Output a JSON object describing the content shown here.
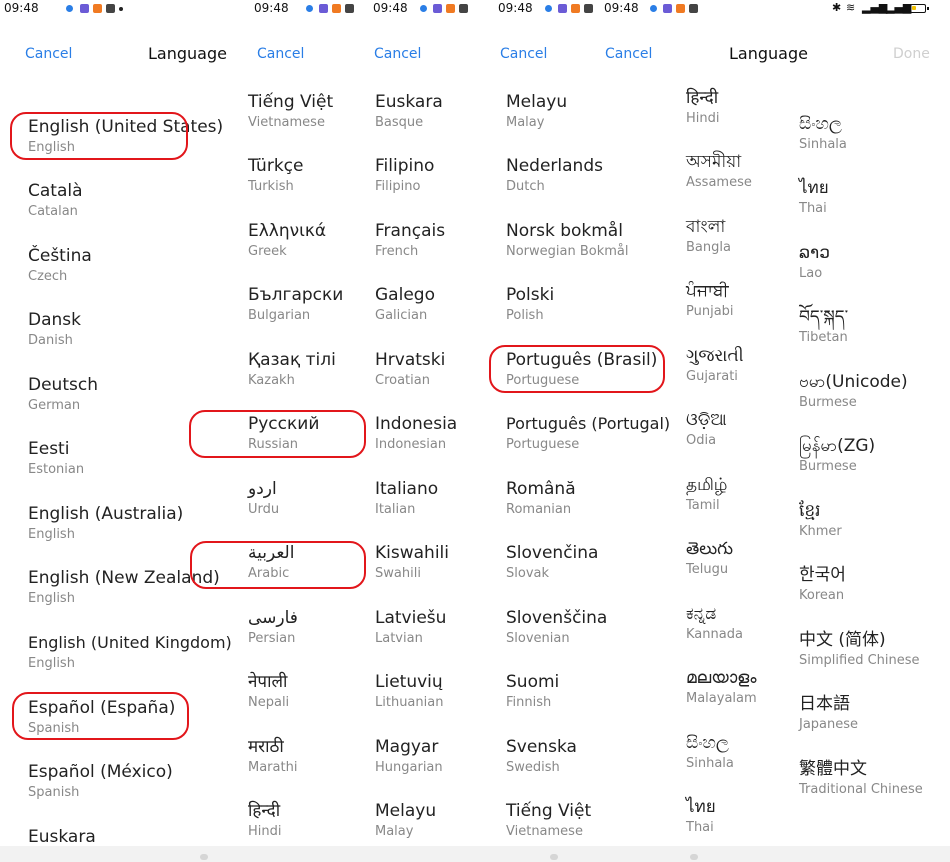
{
  "colors": {
    "accent": "#2a7ee6",
    "highlight": "#e2161b",
    "battery": "#f2c200"
  },
  "status": {
    "time": "09:48",
    "icons": [
      "notification-dot-icon",
      "app-icon",
      "app-icon",
      "app-icon",
      "app-icon"
    ]
  },
  "header": {
    "cancel": "Cancel",
    "title": "Language",
    "done": "Done"
  },
  "panel1": {
    "items": [
      {
        "native": "English (United States)",
        "eng": "English",
        "highlighted": true
      },
      {
        "native": "Català",
        "eng": "Catalan"
      },
      {
        "native": "Čeština",
        "eng": "Czech"
      },
      {
        "native": "Dansk",
        "eng": "Danish"
      },
      {
        "native": "Deutsch",
        "eng": "German"
      },
      {
        "native": "Eesti",
        "eng": "Estonian"
      },
      {
        "native": "English (Australia)",
        "eng": "English"
      },
      {
        "native": "English (New Zealand)",
        "eng": "English"
      },
      {
        "native": "English (United Kingdom)",
        "eng": "English"
      },
      {
        "native": "Español (España)",
        "eng": "Spanish",
        "highlighted": true
      },
      {
        "native": "Español (México)",
        "eng": "Spanish"
      },
      {
        "native": "Euskara",
        "eng": ""
      }
    ]
  },
  "panel2": {
    "items": [
      {
        "native": "Tiếng Việt",
        "eng": "Vietnamese"
      },
      {
        "native": "Türkçe",
        "eng": "Turkish"
      },
      {
        "native": "Ελληνικά",
        "eng": "Greek"
      },
      {
        "native": "Български",
        "eng": "Bulgarian"
      },
      {
        "native": "Қазақ тілі",
        "eng": "Kazakh"
      },
      {
        "native": "Русский",
        "eng": "Russian",
        "highlighted": true
      },
      {
        "native": "اردو",
        "eng": "Urdu"
      },
      {
        "native": "العربية",
        "eng": "Arabic",
        "highlighted": true
      },
      {
        "native": "فارسی",
        "eng": "Persian"
      },
      {
        "native": "नेपाली",
        "eng": "Nepali"
      },
      {
        "native": "मराठी",
        "eng": "Marathi"
      },
      {
        "native": "हिन्दी",
        "eng": "Hindi"
      }
    ]
  },
  "panel3": {
    "items": [
      {
        "native": "Euskara",
        "eng": "Basque"
      },
      {
        "native": "Filipino",
        "eng": "Filipino"
      },
      {
        "native": "Français",
        "eng": "French"
      },
      {
        "native": "Galego",
        "eng": "Galician"
      },
      {
        "native": "Hrvatski",
        "eng": "Croatian"
      },
      {
        "native": "Indonesia",
        "eng": "Indonesian"
      },
      {
        "native": "Italiano",
        "eng": "Italian"
      },
      {
        "native": "Kiswahili",
        "eng": "Swahili"
      },
      {
        "native": "Latviešu",
        "eng": "Latvian"
      },
      {
        "native": "Lietuvių",
        "eng": "Lithuanian"
      },
      {
        "native": "Magyar",
        "eng": "Hungarian"
      },
      {
        "native": "Melayu",
        "eng": "Malay"
      }
    ]
  },
  "panel4": {
    "items": [
      {
        "native": "Melayu",
        "eng": "Malay"
      },
      {
        "native": "Nederlands",
        "eng": "Dutch"
      },
      {
        "native": "Norsk bokmål",
        "eng": "Norwegian Bokmål"
      },
      {
        "native": "Polski",
        "eng": "Polish"
      },
      {
        "native": "Português (Brasil)",
        "eng": "Portuguese",
        "highlighted": true
      },
      {
        "native": "Português (Portugal)",
        "eng": "Portuguese"
      },
      {
        "native": "Română",
        "eng": "Romanian"
      },
      {
        "native": "Slovenčina",
        "eng": "Slovak"
      },
      {
        "native": "Slovenščina",
        "eng": "Slovenian"
      },
      {
        "native": "Suomi",
        "eng": "Finnish"
      },
      {
        "native": "Svenska",
        "eng": "Swedish"
      },
      {
        "native": "Tiếng Việt",
        "eng": "Vietnamese"
      }
    ]
  },
  "panel5": {
    "items": [
      {
        "native": "हिन्दी",
        "eng": "Hindi"
      },
      {
        "native": "অসমীয়া",
        "eng": "Assamese"
      },
      {
        "native": "বাংলা",
        "eng": "Bangla"
      },
      {
        "native": "ਪੰਜਾਬੀ",
        "eng": "Punjabi"
      },
      {
        "native": "ગુજરાતી",
        "eng": "Gujarati"
      },
      {
        "native": "ଓଡ଼ିଆ",
        "eng": "Odia"
      },
      {
        "native": "தமிழ்",
        "eng": "Tamil"
      },
      {
        "native": "తెలుగు",
        "eng": "Telugu"
      },
      {
        "native": "ಕನ್ನಡ",
        "eng": "Kannada"
      },
      {
        "native": "മലയാളം",
        "eng": "Malayalam"
      },
      {
        "native": "සිංහල",
        "eng": "Sinhala"
      },
      {
        "native": "ไทย",
        "eng": "Thai"
      }
    ]
  },
  "panel6": {
    "items": [
      {
        "native": "සිංහල",
        "eng": "Sinhala"
      },
      {
        "native": "ไทย",
        "eng": "Thai"
      },
      {
        "native": "ລາວ",
        "eng": "Lao"
      },
      {
        "native": "བོད་སྐད་",
        "eng": "Tibetan"
      },
      {
        "native": "ဗမာ(Unicode)",
        "eng": "Burmese"
      },
      {
        "native": "မြန်မာ(ZG)",
        "eng": "Burmese"
      },
      {
        "native": "ខ្មែរ",
        "eng": "Khmer"
      },
      {
        "native": "한국어",
        "eng": "Korean"
      },
      {
        "native": "中文 (简体)",
        "eng": "Simplified Chinese"
      },
      {
        "native": "日本語",
        "eng": "Japanese"
      },
      {
        "native": "繁體中文",
        "eng": "Traditional Chinese"
      }
    ]
  }
}
